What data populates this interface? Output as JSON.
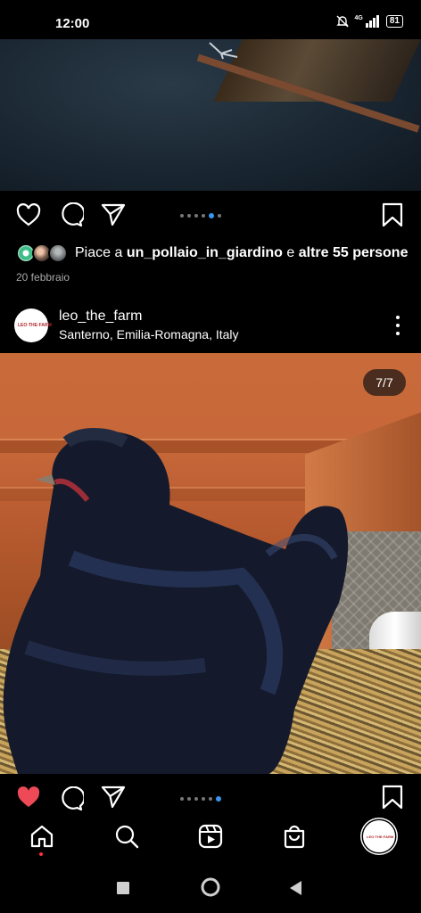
{
  "status": {
    "time": "12:00",
    "network": "4G",
    "battery": "81"
  },
  "post1": {
    "likes_prefix": "Piace a ",
    "liked_by": "un_pollaio_in_giardino",
    "likes_conj": " e ",
    "others": "altre 55 persone",
    "date": "20 febbraio",
    "carousel_count": 6,
    "carousel_active_index": 4
  },
  "post2": {
    "username": "leo_the_farm",
    "location": "Santerno, Emilia-Romagna, Italy",
    "avatar_text": "LEO·THE·FARM",
    "counter": "7/7",
    "liked": true,
    "carousel_count": 6,
    "carousel_active_index": 5
  },
  "nav": {
    "items": [
      "home-icon",
      "search-icon",
      "reels-icon",
      "shop-icon",
      "profile-avatar"
    ],
    "profile_avatar_text": "LEO·THE·FARM"
  },
  "colors": {
    "like_red": "#ed4956",
    "carousel_active": "#3897f0",
    "notification_dot": "#ff3040"
  }
}
